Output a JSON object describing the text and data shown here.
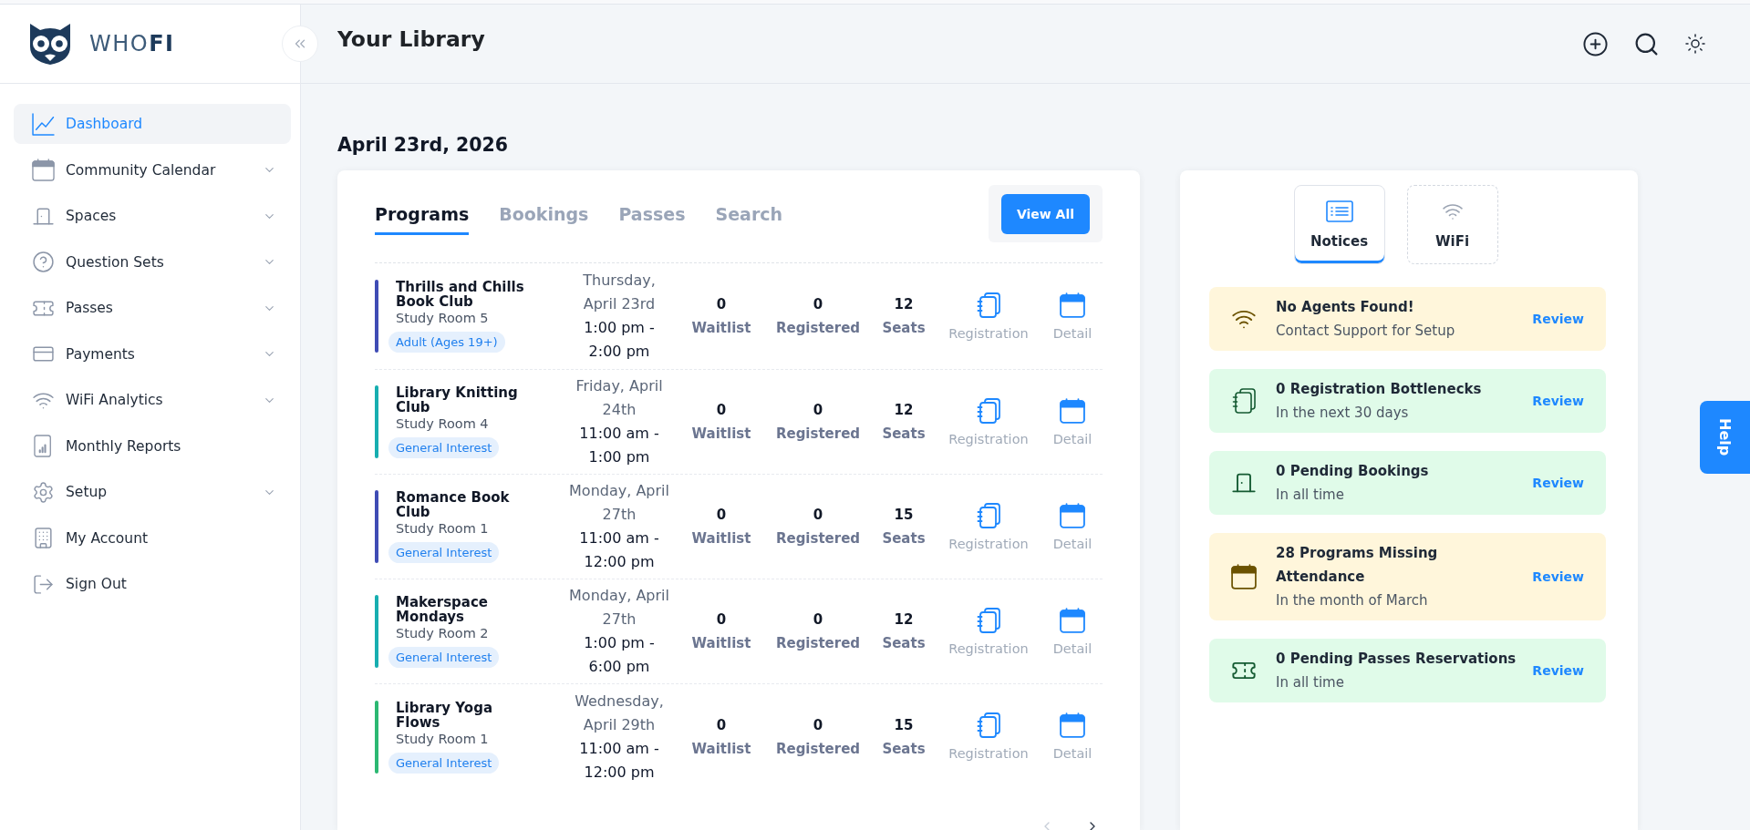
{
  "sidebar": {
    "logo": "WHO**FI**",
    "items": [
      {
        "label": "Dashboard",
        "kind": "link",
        "selected": true
      },
      {
        "label": "Community Calendar",
        "kind": "menu",
        "selected": false
      },
      {
        "label": "Spaces",
        "kind": "menu",
        "selected": false
      },
      {
        "label": "Question Sets",
        "kind": "menu",
        "selected": false
      },
      {
        "label": "Passes",
        "kind": "menu",
        "selected": false
      },
      {
        "label": "Payments",
        "kind": "menu",
        "selected": false
      },
      {
        "label": "WiFi Analytics",
        "kind": "menu",
        "selected": false
      },
      {
        "label": "Monthly Reports",
        "kind": "link",
        "selected": false
      },
      {
        "label": "Setup",
        "kind": "menu",
        "selected": false
      },
      {
        "label": "My Account",
        "kind": "link",
        "selected": false
      },
      {
        "label": "Sign Out",
        "kind": "link",
        "selected": false
      }
    ]
  },
  "header": {
    "title": "Your Library"
  },
  "date_heading": "April 23rd, 2026",
  "programs_panel": {
    "tabs": [
      {
        "label": "Programs",
        "selected": true
      },
      {
        "label": "Bookings",
        "selected": false
      },
      {
        "label": "Passes",
        "selected": false
      },
      {
        "label": "Search",
        "selected": false
      }
    ],
    "view_all_button": "View All",
    "rows": [
      {
        "title": "Thrills and Chills Book Club",
        "room": "Study Room 5",
        "tag": "Adult (Ages 19+)",
        "color": "#3f4cb5",
        "date": "Thursday, April 23rd",
        "time": "1:00 pm - 2:00 pm",
        "stats": [
          {
            "value": "0",
            "label": "Waitlist"
          },
          {
            "value": "0",
            "label": "Registered"
          },
          {
            "value": "12",
            "label": "Seats"
          }
        ],
        "actions": [
          {
            "label": "Registration"
          },
          {
            "label": "Detail"
          }
        ]
      },
      {
        "title": "Library Knitting Club",
        "room": "Study Room 4",
        "tag": "General Interest",
        "color": "#17aeb0",
        "date": "Friday, April 24th",
        "time": "11:00 am - 1:00 pm",
        "stats": [
          {
            "value": "0",
            "label": "Waitlist"
          },
          {
            "value": "0",
            "label": "Registered"
          },
          {
            "value": "12",
            "label": "Seats"
          }
        ],
        "actions": [
          {
            "label": "Registration"
          },
          {
            "label": "Detail"
          }
        ]
      },
      {
        "title": "Romance Book Club",
        "room": "Study Room 1",
        "tag": "General Interest",
        "color": "#3f4cb5",
        "date": "Monday, April 27th",
        "time": "11:00 am - 12:00 pm",
        "stats": [
          {
            "value": "0",
            "label": "Waitlist"
          },
          {
            "value": "0",
            "label": "Registered"
          },
          {
            "value": "15",
            "label": "Seats"
          }
        ],
        "actions": [
          {
            "label": "Registration"
          },
          {
            "label": "Detail"
          }
        ]
      },
      {
        "title": "Makerspace Mondays",
        "room": "Study Room 2",
        "tag": "General Interest",
        "color": "#17aeb0",
        "date": "Monday, April 27th",
        "time": "1:00 pm - 6:00 pm",
        "stats": [
          {
            "value": "0",
            "label": "Waitlist"
          },
          {
            "value": "0",
            "label": "Registered"
          },
          {
            "value": "12",
            "label": "Seats"
          }
        ],
        "actions": [
          {
            "label": "Registration"
          },
          {
            "label": "Detail"
          }
        ]
      },
      {
        "title": "Library Yoga Flows",
        "room": "Study Room 1",
        "tag": "General Interest",
        "color": "#2cb872",
        "date": "Wednesday, April 29th",
        "time": "11:00 am - 12:00 pm",
        "stats": [
          {
            "value": "0",
            "label": "Waitlist"
          },
          {
            "value": "0",
            "label": "Registered"
          },
          {
            "value": "15",
            "label": "Seats"
          }
        ],
        "actions": [
          {
            "label": "Registration"
          },
          {
            "label": "Detail"
          }
        ]
      }
    ],
    "pagination": [
      {
        "kind": "previous",
        "disabled": true
      },
      {
        "kind": "next",
        "disabled": false
      }
    ]
  },
  "notices_panel": {
    "tabs": [
      {
        "label": "Notices",
        "selected": true
      },
      {
        "label": "WiFi",
        "selected": false
      }
    ],
    "notices": [
      {
        "kind": "warning",
        "title": "No Agents Found!",
        "subtitle": "Contact Support for Setup",
        "action": "Review"
      },
      {
        "kind": "ok",
        "title": "0 Registration Bottlenecks",
        "subtitle": "In the next 30 days",
        "action": "Review"
      },
      {
        "kind": "ok",
        "title": "0 Pending Bookings",
        "subtitle": "In all time",
        "action": "Review"
      },
      {
        "kind": "warning",
        "title": "28 Programs Missing Attendance",
        "subtitle": "In the month of March",
        "action": "Review"
      },
      {
        "kind": "ok",
        "title": "0 Pending Passes Reservations",
        "subtitle": "In all time",
        "action": "Review"
      }
    ]
  },
  "help_button": "Help"
}
